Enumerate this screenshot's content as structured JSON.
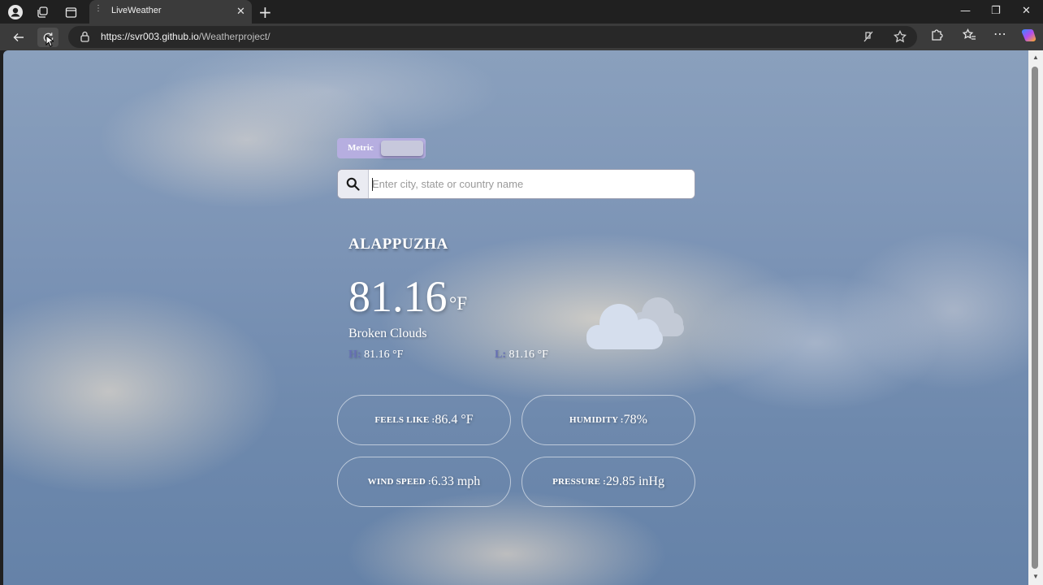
{
  "browser": {
    "tab_title": "LiveWeather",
    "url_host": "https://svr003.github.io",
    "url_path": "/Weatherproject/",
    "new_tab": "+",
    "tab_close": "✕"
  },
  "toggle": {
    "label": "Metric"
  },
  "search": {
    "placeholder": "Enter city, state or country name",
    "value": ""
  },
  "weather": {
    "city": "ALAPPUZHA",
    "temperature": "81.16",
    "temp_unit": "°F",
    "description": "Broken Clouds",
    "high_label": "H:",
    "high_value": "81.16 °F",
    "low_label": "L:",
    "low_value": "81.16 °F",
    "icon": "broken-clouds-icon"
  },
  "cards": {
    "feels_like": {
      "label": "FEELS LIKE :",
      "value": "86.4 °F"
    },
    "humidity": {
      "label": "HUMIDITY :",
      "value": "78%"
    },
    "wind_speed": {
      "label": "WIND SPEED :",
      "value": "6.33 mph"
    },
    "pressure": {
      "label": "PRESSURE :",
      "value": "29.85 inHg"
    }
  },
  "colors": {
    "toggle_bg": "#b6aee0",
    "hl_key": "#6670b4",
    "cloud_front": "#d5deed",
    "cloud_back": "#c3cad6"
  }
}
